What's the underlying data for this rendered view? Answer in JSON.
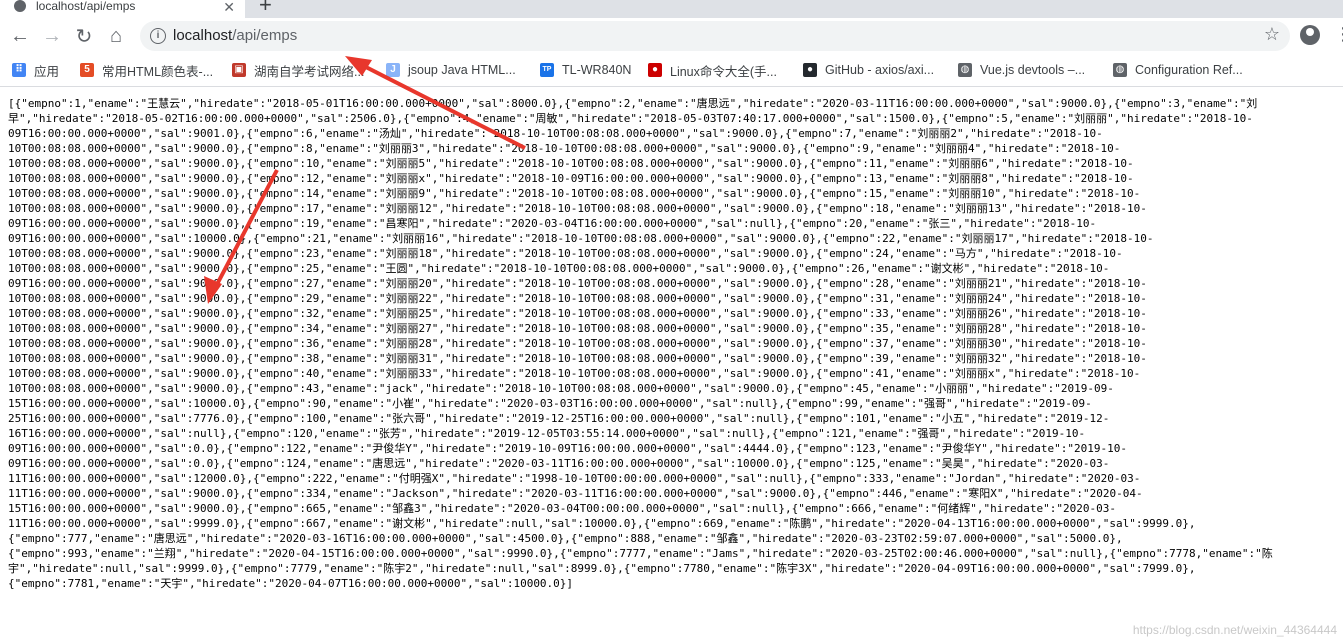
{
  "tab": {
    "title": "localhost/api/emps",
    "close": "✕",
    "new": "+"
  },
  "toolbar": {
    "back": "←",
    "forward": "→",
    "reload": "↻",
    "home": "⌂"
  },
  "omnibox": {
    "info_icon": "i",
    "host": "localhost",
    "path": "/api/emps",
    "star": "☆"
  },
  "menu_icon": "⋮",
  "bookmarks": [
    {
      "label": "应用",
      "icon": "apps-icon",
      "color": "#4285f4"
    },
    {
      "label": "常用HTML颜色表-...",
      "icon": "html5-icon",
      "color": "#e44d26"
    },
    {
      "label": "湖南自学考试网络...",
      "icon": "page-icon",
      "color": "#c0392b"
    },
    {
      "label": "jsoup Java HTML...",
      "icon": "j-icon",
      "color": "#8ab4f8"
    },
    {
      "label": "TL-WR840N",
      "icon": "tplink-icon",
      "color": "#1a73e8"
    },
    {
      "label": "Linux命令大全(手...",
      "icon": "redhat-icon",
      "color": "#cc0000"
    },
    {
      "label": "GitHub - axios/axi...",
      "icon": "github-icon",
      "color": "#24292e"
    },
    {
      "label": "Vue.js devtools –...",
      "icon": "globe-icon",
      "color": "#5f6368"
    },
    {
      "label": "Configuration Ref...",
      "icon": "globe-icon",
      "color": "#5f6368"
    }
  ],
  "json_lines": [
    "[{\"empno\":1,\"ename\":\"王慧云\",\"hiredate\":\"2018-05-01T16:00:00.000+0000\",\"sal\":8000.0},{\"empno\":2,\"ename\":\"唐思远\",\"hiredate\":\"2020-03-11T16:00:00.000+0000\",\"sal\":9000.0},{\"empno\":3,\"ename\":\"刘",
    "早\",\"hiredate\":\"2018-05-02T16:00:00.000+0000\",\"sal\":2506.0},{\"empno\":4,\"ename\":\"周敏\",\"hiredate\":\"2018-05-03T07:40:17.000+0000\",\"sal\":1500.0},{\"empno\":5,\"ename\":\"刘丽丽\",\"hiredate\":\"2018-10-",
    "09T16:00:00.000+0000\",\"sal\":9001.0},{\"empno\":6,\"ename\":\"汤灿\",\"hiredate\":\"2018-10-10T00:08:08.000+0000\",\"sal\":9000.0},{\"empno\":7,\"ename\":\"刘丽丽2\",\"hiredate\":\"2018-10-",
    "10T00:08:08.000+0000\",\"sal\":9000.0},{\"empno\":8,\"ename\":\"刘丽丽3\",\"hiredate\":\"2018-10-10T00:08:08.000+0000\",\"sal\":9000.0},{\"empno\":9,\"ename\":\"刘丽丽4\",\"hiredate\":\"2018-10-",
    "10T00:08:08.000+0000\",\"sal\":9000.0},{\"empno\":10,\"ename\":\"刘丽丽5\",\"hiredate\":\"2018-10-10T00:08:08.000+0000\",\"sal\":9000.0},{\"empno\":11,\"ename\":\"刘丽丽6\",\"hiredate\":\"2018-10-",
    "10T00:08:08.000+0000\",\"sal\":9000.0},{\"empno\":12,\"ename\":\"刘丽丽x\",\"hiredate\":\"2018-10-09T16:00:00.000+0000\",\"sal\":9000.0},{\"empno\":13,\"ename\":\"刘丽丽8\",\"hiredate\":\"2018-10-",
    "10T00:08:08.000+0000\",\"sal\":9000.0},{\"empno\":14,\"ename\":\"刘丽丽9\",\"hiredate\":\"2018-10-10T00:08:08.000+0000\",\"sal\":9000.0},{\"empno\":15,\"ename\":\"刘丽丽10\",\"hiredate\":\"2018-10-",
    "10T00:08:08.000+0000\",\"sal\":9000.0},{\"empno\":17,\"ename\":\"刘丽丽12\",\"hiredate\":\"2018-10-10T00:08:08.000+0000\",\"sal\":9000.0},{\"empno\":18,\"ename\":\"刘丽丽13\",\"hiredate\":\"2018-10-",
    "09T16:00:00.000+0000\",\"sal\":9000.0},{\"empno\":19,\"ename\":\"昌寒阳\",\"hiredate\":\"2020-03-04T16:00:00.000+0000\",\"sal\":null},{\"empno\":20,\"ename\":\"张三\",\"hiredate\":\"2018-10-",
    "09T16:00:00.000+0000\",\"sal\":10000.0},{\"empno\":21,\"ename\":\"刘丽丽16\",\"hiredate\":\"2018-10-10T00:08:08.000+0000\",\"sal\":9000.0},{\"empno\":22,\"ename\":\"刘丽丽17\",\"hiredate\":\"2018-10-",
    "10T00:08:08.000+0000\",\"sal\":9000.0},{\"empno\":23,\"ename\":\"刘丽丽18\",\"hiredate\":\"2018-10-10T00:08:08.000+0000\",\"sal\":9000.0},{\"empno\":24,\"ename\":\"马方\",\"hiredate\":\"2018-10-",
    "10T00:08:08.000+0000\",\"sal\":9000.0},{\"empno\":25,\"ename\":\"王圆\",\"hiredate\":\"2018-10-10T00:08:08.000+0000\",\"sal\":9000.0},{\"empno\":26,\"ename\":\"谢文彬\",\"hiredate\":\"2018-10-",
    "09T16:00:00.000+0000\",\"sal\":9000.0},{\"empno\":27,\"ename\":\"刘丽丽20\",\"hiredate\":\"2018-10-10T00:08:08.000+0000\",\"sal\":9000.0},{\"empno\":28,\"ename\":\"刘丽丽21\",\"hiredate\":\"2018-10-",
    "10T00:08:08.000+0000\",\"sal\":9000.0},{\"empno\":29,\"ename\":\"刘丽丽22\",\"hiredate\":\"2018-10-10T00:08:08.000+0000\",\"sal\":9000.0},{\"empno\":31,\"ename\":\"刘丽丽24\",\"hiredate\":\"2018-10-",
    "10T00:08:08.000+0000\",\"sal\":9000.0},{\"empno\":32,\"ename\":\"刘丽丽25\",\"hiredate\":\"2018-10-10T00:08:08.000+0000\",\"sal\":9000.0},{\"empno\":33,\"ename\":\"刘丽丽26\",\"hiredate\":\"2018-10-",
    "10T00:08:08.000+0000\",\"sal\":9000.0},{\"empno\":34,\"ename\":\"刘丽丽27\",\"hiredate\":\"2018-10-10T00:08:08.000+0000\",\"sal\":9000.0},{\"empno\":35,\"ename\":\"刘丽丽28\",\"hiredate\":\"2018-10-",
    "10T00:08:08.000+0000\",\"sal\":9000.0},{\"empno\":36,\"ename\":\"刘丽丽28\",\"hiredate\":\"2018-10-10T00:08:08.000+0000\",\"sal\":9000.0},{\"empno\":37,\"ename\":\"刘丽丽30\",\"hiredate\":\"2018-10-",
    "10T00:08:08.000+0000\",\"sal\":9000.0},{\"empno\":38,\"ename\":\"刘丽丽31\",\"hiredate\":\"2018-10-10T00:08:08.000+0000\",\"sal\":9000.0},{\"empno\":39,\"ename\":\"刘丽丽32\",\"hiredate\":\"2018-10-",
    "10T00:08:08.000+0000\",\"sal\":9000.0},{\"empno\":40,\"ename\":\"刘丽丽33\",\"hiredate\":\"2018-10-10T00:08:08.000+0000\",\"sal\":9000.0},{\"empno\":41,\"ename\":\"刘丽丽x\",\"hiredate\":\"2018-10-",
    "10T00:08:08.000+0000\",\"sal\":9000.0},{\"empno\":43,\"ename\":\"jack\",\"hiredate\":\"2018-10-10T00:08:08.000+0000\",\"sal\":9000.0},{\"empno\":45,\"ename\":\"小丽丽\",\"hiredate\":\"2019-09-",
    "15T16:00:00.000+0000\",\"sal\":10000.0},{\"empno\":90,\"ename\":\"小崔\",\"hiredate\":\"2020-03-03T16:00:00.000+0000\",\"sal\":null},{\"empno\":99,\"ename\":\"强哥\",\"hiredate\":\"2019-09-",
    "25T16:00:00.000+0000\",\"sal\":7776.0},{\"empno\":100,\"ename\":\"张六哥\",\"hiredate\":\"2019-12-25T16:00:00.000+0000\",\"sal\":null},{\"empno\":101,\"ename\":\"小五\",\"hiredate\":\"2019-12-",
    "16T16:00:00.000+0000\",\"sal\":null},{\"empno\":120,\"ename\":\"张芳\",\"hiredate\":\"2019-12-05T03:55:14.000+0000\",\"sal\":null},{\"empno\":121,\"ename\":\"强哥\",\"hiredate\":\"2019-10-",
    "09T16:00:00.000+0000\",\"sal\":0.0},{\"empno\":122,\"ename\":\"尹俊华Y\",\"hiredate\":\"2019-10-09T16:00:00.000+0000\",\"sal\":4444.0},{\"empno\":123,\"ename\":\"尹俊华Y\",\"hiredate\":\"2019-10-",
    "09T16:00:00.000+0000\",\"sal\":0.0},{\"empno\":124,\"ename\":\"唐思远\",\"hiredate\":\"2020-03-11T16:00:00.000+0000\",\"sal\":10000.0},{\"empno\":125,\"ename\":\"吴昊\",\"hiredate\":\"2020-03-",
    "11T16:00:00.000+0000\",\"sal\":12000.0},{\"empno\":222,\"ename\":\"付明强X\",\"hiredate\":\"1998-10-10T00:00:00.000+0000\",\"sal\":null},{\"empno\":333,\"ename\":\"Jordan\",\"hiredate\":\"2020-03-",
    "11T16:00:00.000+0000\",\"sal\":9000.0},{\"empno\":334,\"ename\":\"Jackson\",\"hiredate\":\"2020-03-11T16:00:00.000+0000\",\"sal\":9000.0},{\"empno\":446,\"ename\":\"寒阳X\",\"hiredate\":\"2020-04-",
    "15T16:00:00.000+0000\",\"sal\":9000.0},{\"empno\":665,\"ename\":\"邹鑫3\",\"hiredate\":\"2020-03-04T00:00:00.000+0000\",\"sal\":null},{\"empno\":666,\"ename\":\"何绪辉\",\"hiredate\":\"2020-03-",
    "11T16:00:00.000+0000\",\"sal\":9999.0},{\"empno\":667,\"ename\":\"谢文彬\",\"hiredate\":null,\"sal\":10000.0},{\"empno\":669,\"ename\":\"陈鹏\",\"hiredate\":\"2020-04-13T16:00:00.000+0000\",\"sal\":9999.0},",
    "{\"empno\":777,\"ename\":\"唐思远\",\"hiredate\":\"2020-03-16T16:00:00.000+0000\",\"sal\":4500.0},{\"empno\":888,\"ename\":\"邹鑫\",\"hiredate\":\"2020-03-23T02:59:07.000+0000\",\"sal\":5000.0},",
    "{\"empno\":993,\"ename\":\"兰翔\",\"hiredate\":\"2020-04-15T16:00:00.000+0000\",\"sal\":9990.0},{\"empno\":7777,\"ename\":\"Jams\",\"hiredate\":\"2020-03-25T02:00:46.000+0000\",\"sal\":null},{\"empno\":7778,\"ename\":\"陈",
    "宇\",\"hiredate\":null,\"sal\":9999.0},{\"empno\":7779,\"ename\":\"陈宇2\",\"hiredate\":null,\"sal\":8999.0},{\"empno\":7780,\"ename\":\"陈宇3X\",\"hiredate\":\"2020-04-09T16:00:00.000+0000\",\"sal\":7999.0},",
    "{\"empno\":7781,\"ename\":\"天宇\",\"hiredate\":\"2020-04-07T16:00:00.000+0000\",\"sal\":10000.0}]"
  ],
  "watermark": "https://blog.csdn.net/weixin_44364444",
  "annotation_color": "#e8372c"
}
